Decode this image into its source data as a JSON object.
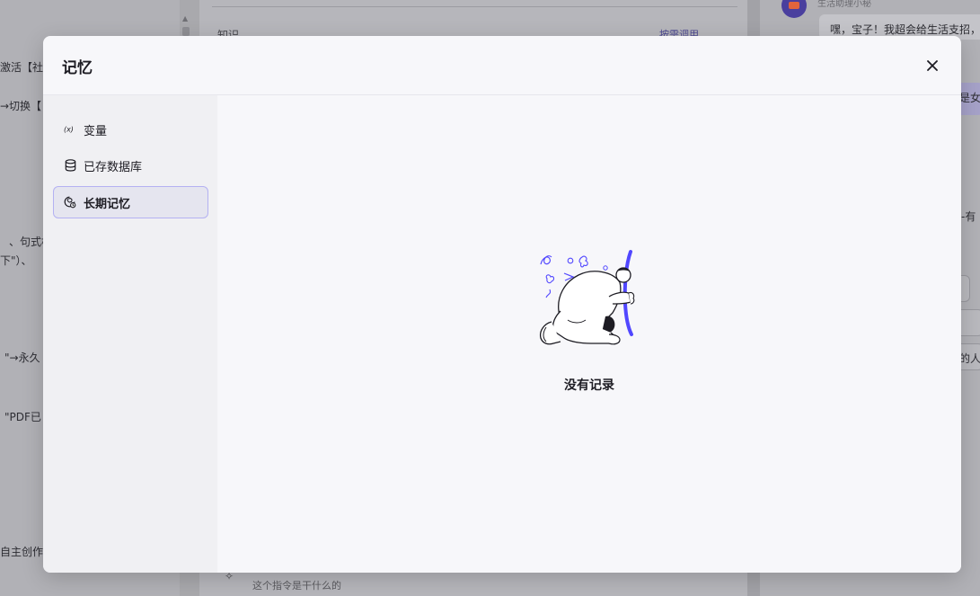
{
  "background": {
    "left_fragments": [
      "激活【社交",
      "→切换【",
      "、句式松",
      "下\"）、",
      "\"→永久",
      "\"PDF已",
      "自主创作"
    ],
    "center": {
      "heading": "知识",
      "on_demand": "按需调用",
      "footer_hint": "这个指令是干什么的"
    },
    "right": {
      "bot_name": "生活助理小秘",
      "greeting": "嘿，宝子！我超会给生活支招，",
      "frag_1": "是女",
      "frag_2": "-有",
      "frag_3": "的人"
    }
  },
  "modal": {
    "title": "记忆",
    "nav": [
      {
        "label": "变量",
        "icon": "variable-icon",
        "active": false
      },
      {
        "label": "已存数据库",
        "icon": "database-icon",
        "active": false
      },
      {
        "label": "长期记忆",
        "icon": "long-term-memory-icon",
        "active": true
      }
    ],
    "empty_state": {
      "text": "没有记录",
      "illustration": "kneeling-person-empty-illustration"
    }
  },
  "colors": {
    "accent": "#5147ff",
    "active_border": "#b4b1f2",
    "active_bg": "#e5e5ef",
    "overlay": "#a9a9ad"
  }
}
